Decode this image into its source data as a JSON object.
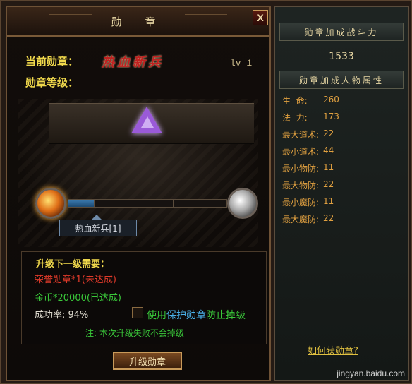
{
  "window": {
    "title": "勋 章",
    "close_label": "X"
  },
  "medal": {
    "current_label": "当前勋章：",
    "current_name": "热血新兵",
    "level_text": "lv 1",
    "grade_label": "勋章等级：",
    "tooltip": "热血新兵[1]",
    "progress_filled_segments": 1,
    "progress_total_segments": 6
  },
  "requirements": {
    "title": "升级下一级需要：",
    "honor_item": "荣誉勋章*1(未达成)",
    "gold_item": "金币*20000(已达成)",
    "success_rate": "成功率: 94%",
    "protect_prefix": "使用",
    "protect_link": "保护勋章",
    "protect_suffix": "防止掉级",
    "note": "注: 本次升级失败不会掉级"
  },
  "upgrade_button": "升级勋章",
  "side": {
    "power_header": "勋章加成战斗力",
    "power_value": "1533",
    "attr_header": "勋章加成人物属性",
    "attributes": [
      {
        "label": "生  命:",
        "value": "260"
      },
      {
        "label": "法  力:",
        "value": "173"
      },
      {
        "label": "最大道术:",
        "value": "22"
      },
      {
        "label": "最小道术:",
        "value": "44"
      },
      {
        "label": "最小物防:",
        "value": "11"
      },
      {
        "label": "最大物防:",
        "value": "22"
      },
      {
        "label": "最小魔防:",
        "value": "11"
      },
      {
        "label": "最大魔防:",
        "value": "22"
      }
    ],
    "link": "如何获勋章?"
  },
  "watermark": "jingyan.baidu.com"
}
